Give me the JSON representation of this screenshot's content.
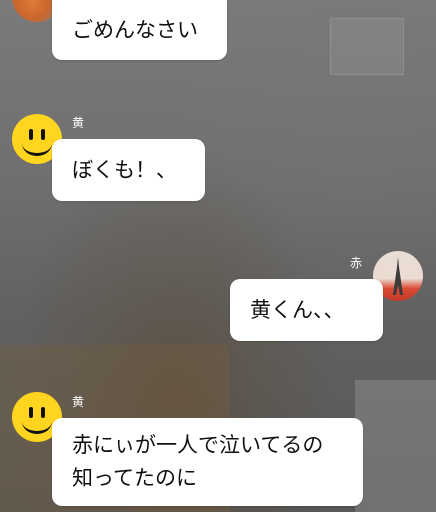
{
  "messages": [
    {
      "side": "left",
      "sender": "",
      "text": "ごめんなさい"
    },
    {
      "side": "left",
      "sender": "黄",
      "text": "ぼくも！、"
    },
    {
      "side": "right",
      "sender": "赤",
      "text": "黄くん、、"
    },
    {
      "side": "left",
      "sender": "黄",
      "lines": [
        "赤にぃが一人で泣いてるの",
        "知ってたのに"
      ]
    }
  ],
  "colors": {
    "bubble": "#ffffff",
    "smiley": "#ffd51f",
    "name_text": "#ffffff"
  },
  "icons": [
    "orange-photo-avatar",
    "smiley-face-avatar",
    "eiffel-tower-avatar"
  ]
}
